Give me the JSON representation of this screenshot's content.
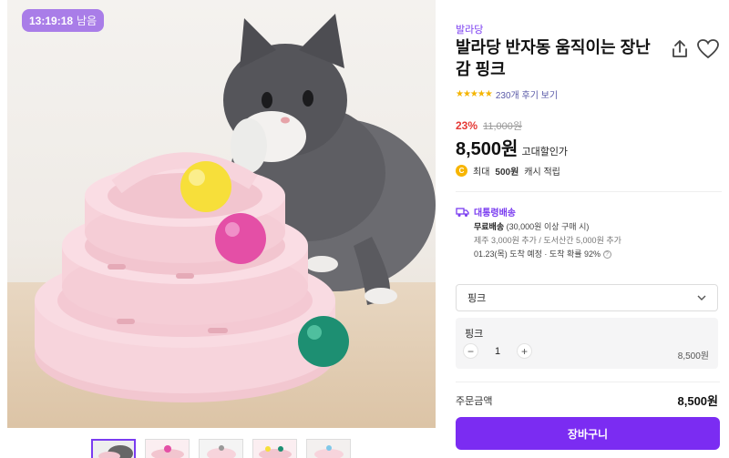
{
  "timer": {
    "time": "13:19:18",
    "suffix": "남음"
  },
  "product": {
    "brand": "발라당",
    "title": "발라당 반자동 움직이는 장난감 핑크",
    "stars": "★★★★★",
    "reviews": "230개 후기 보기",
    "discount": "23%",
    "original_price": "11,000원",
    "price": "8,500원",
    "price_tag": "고대할인가",
    "cash_icon": "C",
    "cash_prefix": "최대",
    "cash_amount": "500원",
    "cash_suffix": "캐시 적립"
  },
  "shipping": {
    "icon": "truck-icon",
    "title": "대통령배송",
    "free": "무료배송",
    "free_note": "(30,000원 이상 구매 시)",
    "extra": "제주 3,000원 추가 / 도서산간 5,000원 추가",
    "eta": "01.23(목) 도착 예정 · 도착 확률 92%",
    "info_icon": "?"
  },
  "option": {
    "select_value": "핑크",
    "selected_name": "핑크",
    "minus": "−",
    "quantity": "1",
    "plus": "+",
    "line_price": "8,500원"
  },
  "order": {
    "total_label": "주문금액",
    "total_value": "8,500원",
    "cart_button": "장바구니"
  },
  "colors": {
    "accent": "#7b2cf2",
    "discount": "#e53935",
    "timer_bg": "#a97de8",
    "star": "#f4b400"
  }
}
